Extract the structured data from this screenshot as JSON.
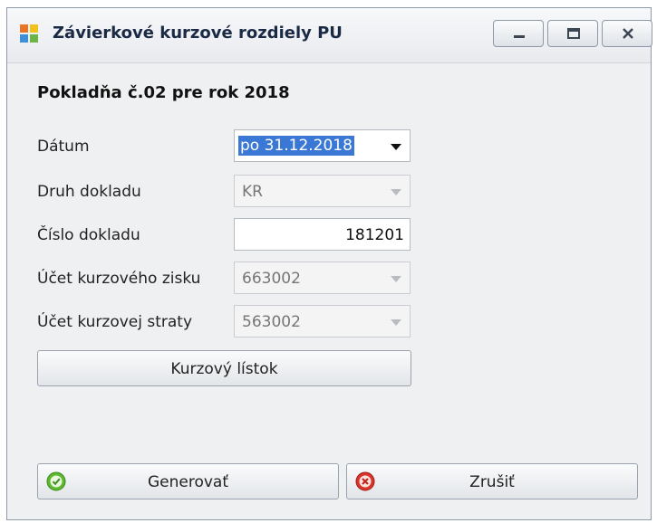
{
  "window": {
    "title": "Závierkové kurzové rozdiely PU",
    "controls": {
      "minimize": "minimize-icon",
      "maximize": "maximize-icon",
      "close": "close-icon"
    }
  },
  "heading": "Pokladňa č.02 pre rok 2018",
  "form": {
    "datum": {
      "label": "Dátum",
      "value": "po 31.12.2018"
    },
    "druh_dokladu": {
      "label": "Druh dokladu",
      "value": "KR"
    },
    "cislo_dokladu": {
      "label": "Číslo dokladu",
      "value": "181201"
    },
    "ucet_zisku": {
      "label": "Účet kurzového zisku",
      "value": "663002"
    },
    "ucet_straty": {
      "label": "Účet kurzovej straty",
      "value": "563002"
    }
  },
  "buttons": {
    "kurzovy_listok": "Kurzový lístok",
    "generovat": "Generovať",
    "zrusit": "Zrušiť"
  },
  "colors": {
    "accent": "#3b78d6",
    "ok": "#5cb82e",
    "cancel": "#d9342b"
  }
}
